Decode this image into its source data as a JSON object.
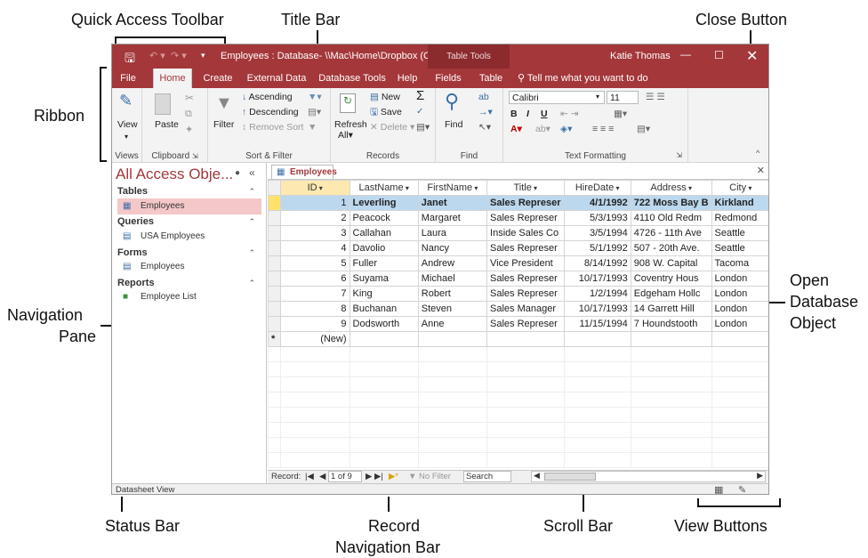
{
  "callouts": {
    "quick_access": "Quick Access Toolbar",
    "title_bar": "Title Bar",
    "close_button": "Close Button",
    "ribbon": "Ribbon",
    "navigation_pane_1": "Navigation",
    "navigation_pane_2": "Pane",
    "open_db_1": "Open",
    "open_db_2": "Database",
    "open_db_3": "Object",
    "status_bar": "Status Bar",
    "record_nav_1": "Record",
    "record_nav_2": "Navigation Bar",
    "scroll_bar": "Scroll Bar",
    "view_buttons": "View Buttons"
  },
  "window": {
    "title": "Employees : Database- \\\\Mac\\Home\\Dropbox (C...",
    "context_tab": "Table Tools",
    "user": "Katie Thomas",
    "brand_color": "#a4373a"
  },
  "tabs": [
    "File",
    "Home",
    "Create",
    "External Data",
    "Database Tools",
    "Help",
    "Fields",
    "Table"
  ],
  "tell_me": "Tell me what you want to do",
  "ribbon": {
    "views": {
      "view": "View",
      "label": "Views"
    },
    "clipboard": {
      "paste": "Paste",
      "label": "Clipboard"
    },
    "sort_filter": {
      "filter": "Filter",
      "ascending": "Ascending",
      "descending": "Descending",
      "remove_sort": "Remove Sort",
      "label": "Sort & Filter"
    },
    "records": {
      "refresh": "Refresh",
      "all": "All",
      "new": "New",
      "save": "Save",
      "delete": "Delete",
      "label": "Records"
    },
    "find": {
      "find": "Find",
      "label": "Find"
    },
    "text_formatting": {
      "font": "Calibri",
      "size": "11",
      "label": "Text Formatting"
    }
  },
  "nav": {
    "title": "All Access Obje...",
    "sections": [
      {
        "name": "Tables",
        "items": [
          "Employees"
        ]
      },
      {
        "name": "Queries",
        "items": [
          "USA Employees"
        ]
      },
      {
        "name": "Forms",
        "items": [
          "Employees"
        ]
      },
      {
        "name": "Reports",
        "items": [
          "Employee List"
        ]
      }
    ]
  },
  "document": {
    "tab": "Employees",
    "columns": [
      "ID",
      "LastName",
      "FirstName",
      "Title",
      "HireDate",
      "Address",
      "City"
    ],
    "rows": [
      [
        "1",
        "Leverling",
        "Janet",
        "Sales Represer",
        "4/1/1992",
        "722 Moss Bay B",
        "Kirkland"
      ],
      [
        "2",
        "Peacock",
        "Margaret",
        "Sales Represer",
        "5/3/1993",
        "4110 Old Redm",
        "Redmond"
      ],
      [
        "3",
        "Callahan",
        "Laura",
        "Inside Sales Co",
        "3/5/1994",
        "4726 - 11th Ave",
        "Seattle"
      ],
      [
        "4",
        "Davolio",
        "Nancy",
        "Sales Represer",
        "5/1/1992",
        "507 - 20th Ave.",
        "Seattle"
      ],
      [
        "5",
        "Fuller",
        "Andrew",
        "Vice President",
        "8/14/1992",
        "908 W. Capital",
        "Tacoma"
      ],
      [
        "6",
        "Suyama",
        "Michael",
        "Sales Represer",
        "10/17/1993",
        "Coventry Hous",
        "London"
      ],
      [
        "7",
        "King",
        "Robert",
        "Sales Represer",
        "1/2/1994",
        "Edgeham Hollc",
        "London"
      ],
      [
        "8",
        "Buchanan",
        "Steven",
        "Sales Manager",
        "10/17/1993",
        "14 Garrett Hill",
        "London"
      ],
      [
        "9",
        "Dodsworth",
        "Anne",
        "Sales Represer",
        "11/15/1994",
        "7 Houndstooth",
        "London"
      ]
    ],
    "new_row": "(New)"
  },
  "record_nav": {
    "label": "Record:",
    "position": "1 of 9",
    "filter": "No Filter",
    "search": "Search"
  },
  "status": {
    "text": "Datasheet View"
  }
}
